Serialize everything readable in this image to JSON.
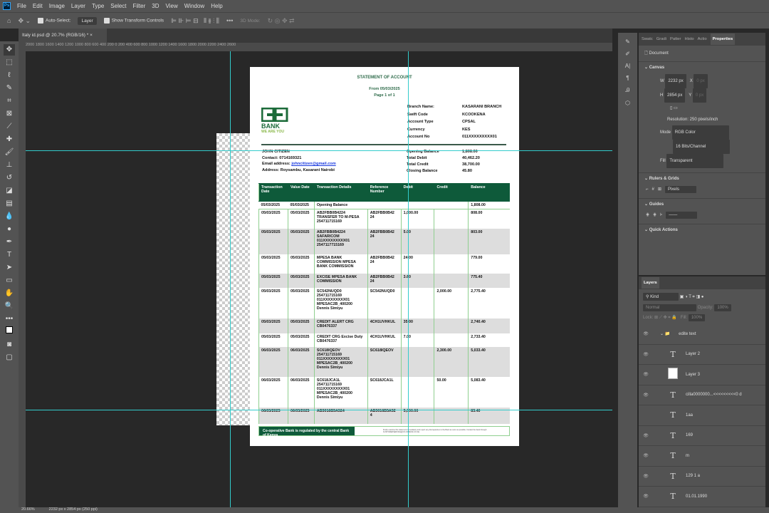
{
  "menu": [
    "File",
    "Edit",
    "Image",
    "Layer",
    "Type",
    "Select",
    "Filter",
    "3D",
    "View",
    "Window",
    "Help"
  ],
  "options": {
    "auto_select": "Auto-Select:",
    "layer": "Layer",
    "show_transform": "Show Transform Controls",
    "mode3d": "3D Mode:"
  },
  "tab": "Italy id.psd @ 20.7% (RGB/16) *",
  "ruler": "2000   1800   1600   1400   1200   1000   800   600   400   200   0   200   400   600   800   1000   1200   1400   1600   1800   2000   2200   2400   2600",
  "doc": {
    "title": "STATEMENT OF ACCOUNT",
    "from": "From 05/03/2025",
    "page": "Page 1 of 1",
    "logo_text": "BANK",
    "tagline": "WE ARE YOU",
    "info": [
      [
        "Branch Name:",
        "KASARANI BRANCH"
      ],
      [
        "Swift Code",
        "KCOOKENA"
      ],
      [
        "Account Type",
        "CPSAL"
      ],
      [
        "Currency",
        "KES"
      ],
      [
        "Account No",
        "011XXXXXXXXX01"
      ]
    ],
    "name": "JOHN CITIZEN",
    "contact": "Contact: 0714169321",
    "email_label": "Email address: ",
    "email": "johncitizen@gmail.com",
    "address": "Address: Roysambu, Kasarani Nairobi",
    "summary": [
      [
        "Opening Balance",
        "1,808.00"
      ],
      [
        "Total Debit",
        "40,462.20"
      ],
      [
        "Total Credit",
        "38,700.00"
      ],
      [
        "Closing Balance",
        "45.80"
      ]
    ],
    "headers": [
      "Transaction Date",
      "Value Date",
      "Transaction Details",
      "Reference Number",
      "Debit",
      "Credit",
      "Balance"
    ],
    "opening": [
      "05/03/2025",
      "05/03/2025",
      "Opening Balance",
      "1,808.00"
    ],
    "rows": [
      [
        "05/03/2025",
        "05/03/2025",
        "AB2FBB0B4224 TRANSFER TO M-PESA 254711715169",
        "AB2FBB0B42 24",
        "1,000.00",
        "",
        "808.00"
      ],
      [
        "05/03/2025",
        "05/03/2025",
        "AB2FBB0B4224 SAFARICOM 011XXXXXXXXX01 2547117715169",
        "AB2FBB0B42 24",
        "5.00",
        "",
        "803.00"
      ],
      [
        "05/03/2025",
        "05/03/2025",
        "MPESA BANK COMMISSION MPESA BANK COMMISSION",
        "AB2FBB0B42 24",
        "24.00",
        "",
        "779.00"
      ],
      [
        "05/03/2025",
        "05/03/2025",
        "EXCISE MPESA BANK COMMISSION",
        "AB2FBB0B42 24",
        "3.60",
        "",
        "775.40"
      ],
      [
        "05/03/2025",
        "05/03/2025",
        "SC542NUQD0 254711715169 011XXXXXXXXX01 MPESAC2B_400200 Dennis Simiyu",
        "SC542NUQD0",
        "",
        "2,000.00",
        "2,775.40"
      ],
      [
        "05/03/2025",
        "05/03/2025",
        "CREDIT ALERT CRG CB0476337",
        "4CH1UVHKUL",
        "35.00",
        "",
        "2,740.40"
      ],
      [
        "05/03/2025",
        "05/03/2025",
        "CREDIT CRG Excise Duty CB0476337",
        "4CH1UVHKUL",
        "7.00",
        "",
        "2,733.40"
      ],
      [
        "06/03/2025",
        "06/03/2025",
        "SC618IQEOV 254711715169 011XXXXXXXXX01 MPESAC2B_400200 Dennis Simiyu",
        "SC618IQEOV",
        "",
        "2,300.00",
        "5,033.40"
      ],
      [
        "06/03/2025",
        "06/03/2025",
        "SC618JCA1L 254711715169 011XXXXXXXXX01 MPESAC2B_400200 Dennis Simiyu",
        "SC618JCA1L",
        "",
        "50.00",
        "5,083.40"
      ],
      [
        "06/03/2025",
        "06/03/2025",
        "AB3016B5A524",
        "AB3016B5A52 4",
        "5,000.00",
        "",
        "83.40"
      ]
    ],
    "footer": "Co-operative Bank is regulated by the central Bank of Kenya",
    "footer_note": "Kindly examine this statement immediately and report any discrepancies to the Bank as soon as possible. Contact the bank through CUSTOMERSERVICE@CO-OPBANK.CO.KE"
  },
  "props": {
    "tabs": [
      "Swatc",
      "Gradi",
      "Patter",
      "Histo",
      "Actio",
      "Properties"
    ],
    "document": "Document",
    "canvas": "Canvas",
    "w_label": "W",
    "w": "2232 px",
    "h_label": "H",
    "h": "2854 px",
    "x_label": "X",
    "y_label": "Y",
    "x": "0 px",
    "y": "0 px",
    "resolution": "Resolution: 250 pixels/inch",
    "mode_label": "Mode",
    "mode": "RGB Color",
    "depth": "16 Bits/Channel",
    "fill_label": "Fill",
    "fill": "Transparent",
    "rulers": "Rulers & Grids",
    "units": "Pixels",
    "guides": "Guides",
    "quick": "Quick Actions"
  },
  "layers": {
    "title": "Layers",
    "kind": "Kind",
    "blend": "Normal",
    "opacity_label": "Opacity:",
    "opacity": "100%",
    "lock_label": "Lock:",
    "fill_label": "Fill:",
    "fill": "100%",
    "items": [
      {
        "name": "edite text",
        "type": "group"
      },
      {
        "name": "Layer 2",
        "type": "text"
      },
      {
        "name": "Layer 3",
        "type": "pixel"
      },
      {
        "name": "cilla0000000...<<<<<<<<<0 d",
        "type": "text"
      },
      {
        "name": "1aa",
        "type": "text",
        "hidden": true
      },
      {
        "name": "169",
        "type": "text"
      },
      {
        "name": "m",
        "type": "text"
      },
      {
        "name": "129 1 a",
        "type": "text"
      },
      {
        "name": "01.01.1990",
        "type": "text"
      }
    ]
  },
  "status": {
    "zoom": "20.66%",
    "size": "2232 px x 2854 px (250 ppi)"
  }
}
